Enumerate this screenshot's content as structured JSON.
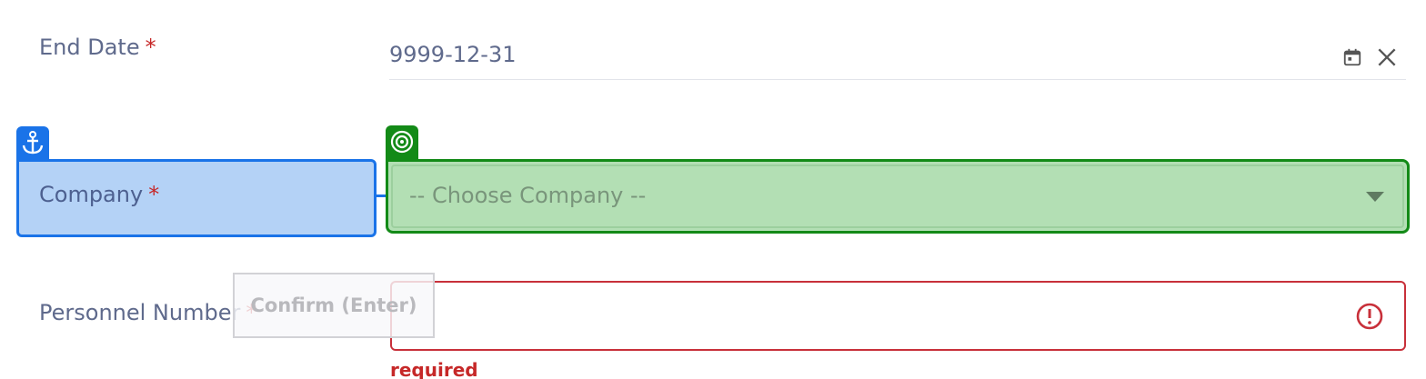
{
  "form": {
    "end_date": {
      "label": "End Date",
      "required_mark": "*",
      "value": "9999-12-31",
      "calendar_icon": "calendar-icon",
      "clear_icon": "close-icon"
    },
    "company": {
      "label": "Company",
      "required_mark": "*",
      "placeholder": "-- Choose Company --",
      "dropdown_icon": "chevron-down-icon"
    },
    "personnel_number": {
      "label": "Personnel Number",
      "required_mark": "*",
      "value": "",
      "error_icon": "error-circle-icon",
      "error_text": "required"
    }
  },
  "overlay": {
    "anchor_icon": "anchor-icon",
    "target_icon": "target-icon",
    "confirm_label": "Confirm (Enter)"
  },
  "colors": {
    "anchor": "#1a73e8",
    "anchor_fill": "#b4d2f6",
    "target": "#138a17",
    "target_fill": "#b3dfb4",
    "error": "#c62828",
    "label": "#5f6a8c"
  }
}
